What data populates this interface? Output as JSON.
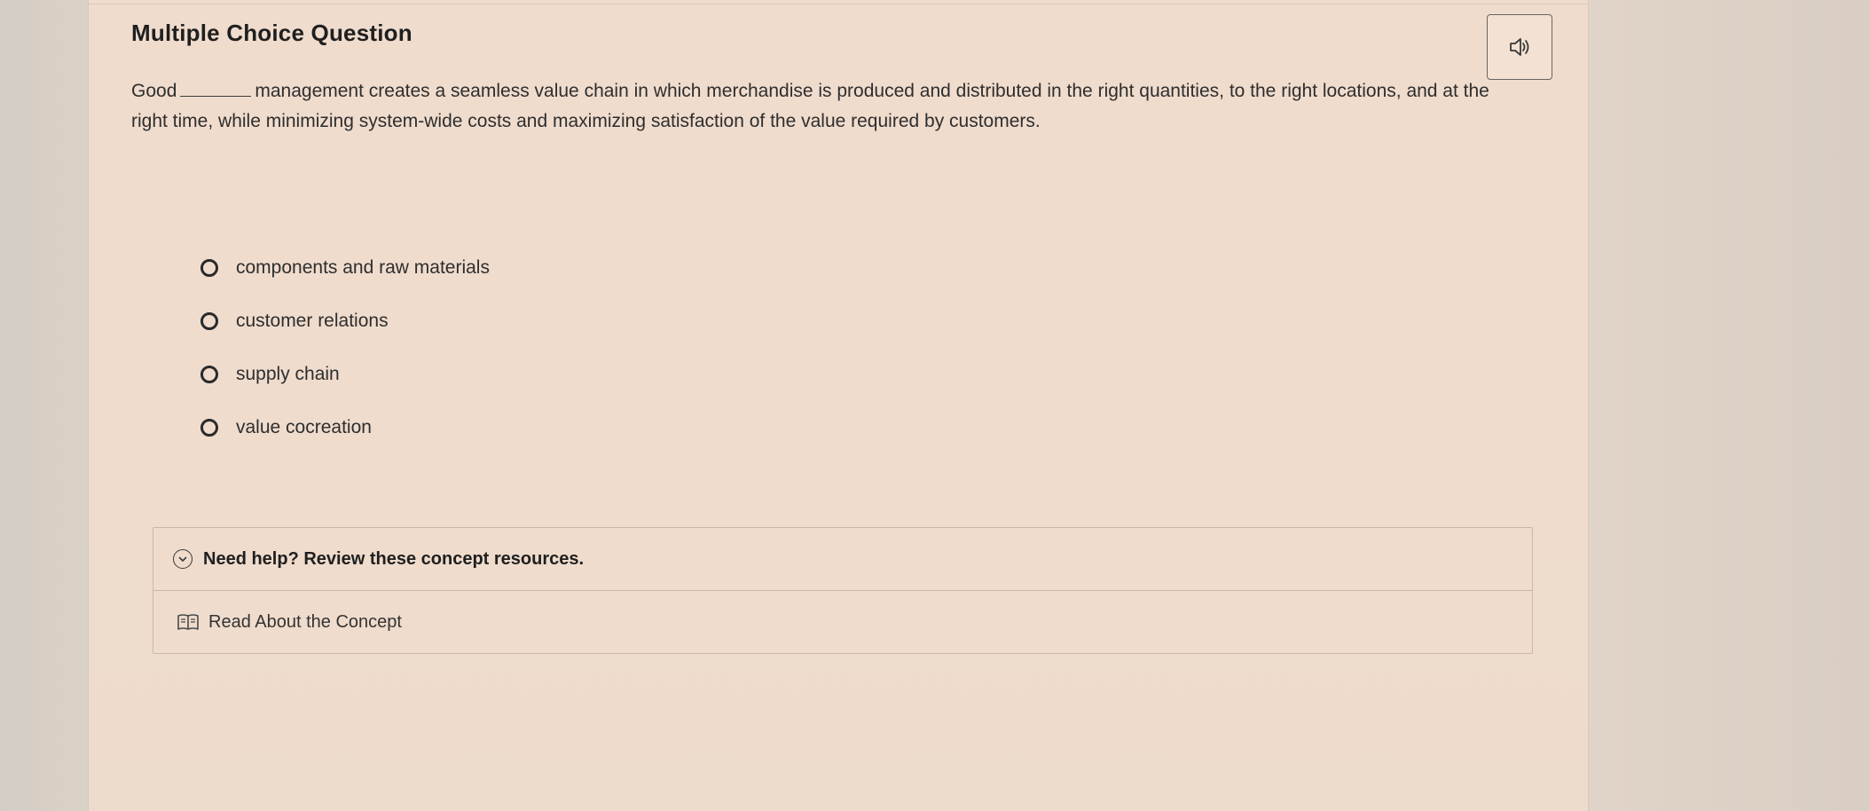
{
  "question": {
    "type_label": "Multiple Choice Question",
    "prompt_before_blank": "Good",
    "prompt_after_blank": "management creates a seamless value chain in which merchandise is produced and distributed in the right quantities, to the right locations, and at the right time, while minimizing system-wide costs and maximizing satisfaction of the value required by customers."
  },
  "choices": [
    {
      "label": "components and raw materials"
    },
    {
      "label": "customer relations"
    },
    {
      "label": "supply chain"
    },
    {
      "label": "value cocreation"
    }
  ],
  "help": {
    "title": "Need help? Review these concept resources.",
    "link_label": "Read About the Concept"
  },
  "icons": {
    "audio": "speaker-icon",
    "expand": "chevron-down-circle-icon",
    "book": "book-icon"
  }
}
